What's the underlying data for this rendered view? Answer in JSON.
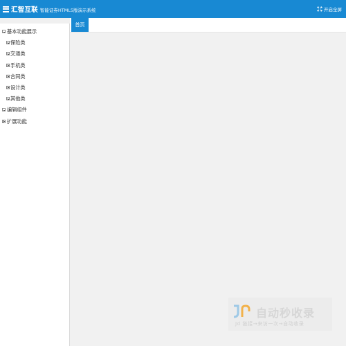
{
  "header": {
    "brand": "汇智互联",
    "subtitle": "智能证券HTML5版演示系统",
    "fullscreen_label": "开启全屏"
  },
  "sidebar": {
    "tree": [
      {
        "label": "基本功能展示",
        "level": 0,
        "expanded": true
      },
      {
        "label": "保险类",
        "level": 1,
        "expanded": false
      },
      {
        "label": "交通类",
        "level": 1,
        "expanded": false
      },
      {
        "label": "手机类",
        "level": 1,
        "expanded": false
      },
      {
        "label": "合同类",
        "level": 1,
        "expanded": false
      },
      {
        "label": "设计类",
        "level": 1,
        "expanded": false
      },
      {
        "label": "其他类",
        "level": 1,
        "expanded": false
      },
      {
        "label": "编辑组件",
        "level": 0,
        "expanded": true
      },
      {
        "label": "扩展功能",
        "level": 0,
        "expanded": false
      }
    ]
  },
  "tabs": [
    {
      "label": "首页"
    }
  ],
  "watermark": {
    "title": "自动秒收录",
    "subtitle": "Jd 链接→来访一次→自动收录"
  },
  "colors": {
    "accent": "#1889d3",
    "content_bg": "#f1f1f1"
  },
  "icons": {
    "brand": "menu-icon",
    "fullscreen": "expand-arrows-icon"
  }
}
